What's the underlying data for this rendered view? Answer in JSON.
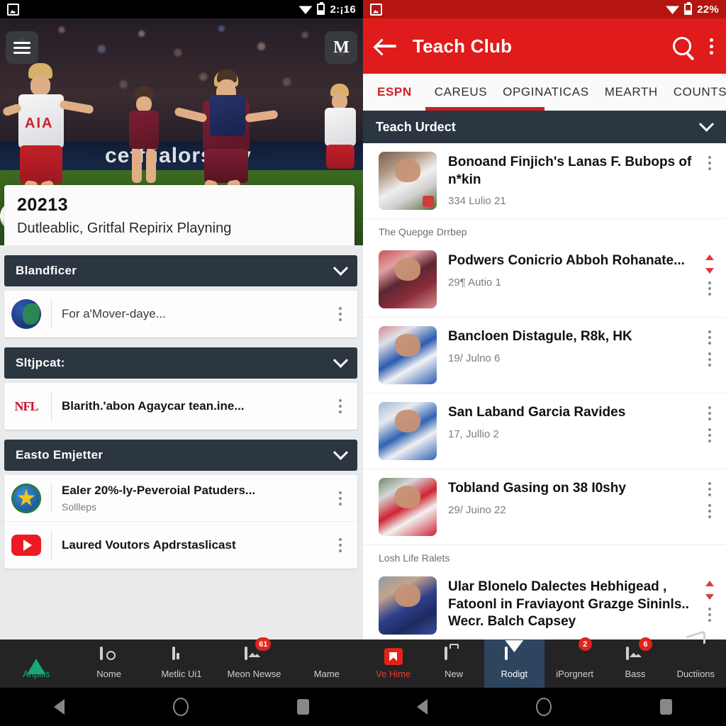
{
  "left": {
    "status": {
      "photo_icon": "photo-icon",
      "wifi_icon": "wifi-icon",
      "battery_icon": "battery-icon",
      "time": "2:¡16"
    },
    "hero": {
      "menu_icon": "hamburger-menu-icon",
      "logo_text": "M",
      "board_text": "cefflialors viv",
      "shirt_sponsor": "AIA",
      "card_number": "20213",
      "card_subtitle": "Dutleablic, Gritfal Repirix Playning"
    },
    "sections": [
      {
        "header": "Blandficer",
        "chevron_icon": "chevron-down-icon",
        "rows": [
          {
            "icon": "globe-icon",
            "title": "For a'Mover-daye...",
            "subtitle": "",
            "bold": false,
            "menu_icon": "kebab-menu-icon"
          }
        ]
      },
      {
        "header": "Sltjpcat:",
        "chevron_icon": "chevron-down-icon",
        "rows": [
          {
            "icon": "nfl-logo-icon",
            "title": "Blarith.'abon Agaycar tean.ine...",
            "subtitle": "",
            "bold": true,
            "menu_icon": "kebab-menu-icon"
          }
        ]
      },
      {
        "header": "Easto Emjetter",
        "chevron_icon": "chevron-down-icon",
        "rows": [
          {
            "icon": "star-badge-icon",
            "title": "Ealer 20%-ly-Peveroial Patuders...",
            "subtitle": "Sollleps",
            "bold": true,
            "menu_icon": "kebab-menu-icon"
          },
          {
            "icon": "youtube-icon",
            "title": "Laured Voutors Apdrstaslicast",
            "subtitle": "",
            "bold": true,
            "menu_icon": "kebab-menu-icon"
          }
        ]
      }
    ],
    "tabbar": [
      {
        "label": "Anpilis",
        "icon": "arrow-up-icon",
        "state": "active-green",
        "badge": ""
      },
      {
        "label": "Nome",
        "icon": "camera-icon",
        "state": "",
        "badge": ""
      },
      {
        "label": "Metlic Ui1",
        "icon": "device-icon",
        "state": "",
        "badge": ""
      },
      {
        "label": "Meon Newse",
        "icon": "card-image-icon",
        "state": "",
        "badge": "61"
      },
      {
        "label": "Mame",
        "icon": "leaf-icon",
        "state": "",
        "badge": ""
      }
    ]
  },
  "right": {
    "status": {
      "photo_icon": "photo-icon",
      "wifi_icon": "wifi-icon",
      "battery_icon": "battery-icon",
      "battery_pct": "22%"
    },
    "appbar": {
      "back_icon": "back-arrow-icon",
      "title": "Teach Club",
      "search_icon": "search-icon",
      "overflow_icon": "overflow-menu-icon"
    },
    "tabs": [
      {
        "label": "ESPN",
        "selected_color": true
      },
      {
        "label": "CAREUS",
        "selected_color": false
      },
      {
        "label": "OPGINATICAS",
        "selected_color": false
      },
      {
        "label": "MEARTH",
        "selected_color": false
      },
      {
        "label": "COUNTS",
        "selected_color": false
      }
    ],
    "section_header": {
      "label": "Teach Urdect",
      "chevron_icon": "chevron-down-icon"
    },
    "items": [
      {
        "title": "Bonoand Finjich's Lanas F. Bubops of n*kin",
        "subtitle": "334 Lulio 21",
        "thumb": "th1",
        "has_arrows": false,
        "has_kebab": true,
        "lines": 2
      },
      {
        "group_label": "The Quepge Drrbep"
      },
      {
        "title": "Podwers Conicrio Abboh Rohanate...",
        "subtitle": "29¶ Autio 1",
        "thumb": "th2",
        "has_arrows": true,
        "has_kebab": true,
        "lines": 1
      },
      {
        "title": "Bancloen Distagule, R8k, HK",
        "subtitle": "19/ Julno 6",
        "thumb": "th3",
        "has_arrows": false,
        "has_kebab": true,
        "lines": 1
      },
      {
        "title": "San Laband Garcia Ravides",
        "subtitle": "17, Jullio 2",
        "thumb": "th4",
        "has_arrows": false,
        "has_kebab": true,
        "lines": 1
      },
      {
        "title": "Tobland Gasing on 38 I0shy",
        "subtitle": "29/ Juino 22",
        "thumb": "th5",
        "has_arrows": false,
        "has_kebab": true,
        "lines": 1
      },
      {
        "group_label": "Losh Life Ralets"
      },
      {
        "title": "Ular Blonelo Dalectes Hebhigead , Fatoonl in Fraviayont Grazge Sininls.. Wecr. Balch Capsey",
        "subtitle": "",
        "thumb": "th6",
        "has_arrows": true,
        "has_kebab": true,
        "lines": 3
      }
    ],
    "tabbar": [
      {
        "label": "Ve Hime",
        "icon": "flag-icon",
        "state": "active-red",
        "badge": ""
      },
      {
        "label": "New",
        "icon": "briefcase-icon",
        "state": "",
        "badge": ""
      },
      {
        "label": "Rodigt",
        "icon": "mail-icon",
        "state": "sel",
        "badge": ""
      },
      {
        "label": "iPorgnert",
        "icon": "list-lines-icon",
        "state": "",
        "badge": "2"
      },
      {
        "label": "Bass",
        "icon": "image-card-icon",
        "state": "",
        "badge": "6"
      },
      {
        "label": "Ductiions",
        "icon": "trend-arrow-icon",
        "state": "",
        "badge": ""
      }
    ]
  },
  "navbar": {
    "back_icon": "nav-back-icon",
    "home_icon": "nav-home-icon",
    "recents_icon": "nav-recents-icon"
  }
}
